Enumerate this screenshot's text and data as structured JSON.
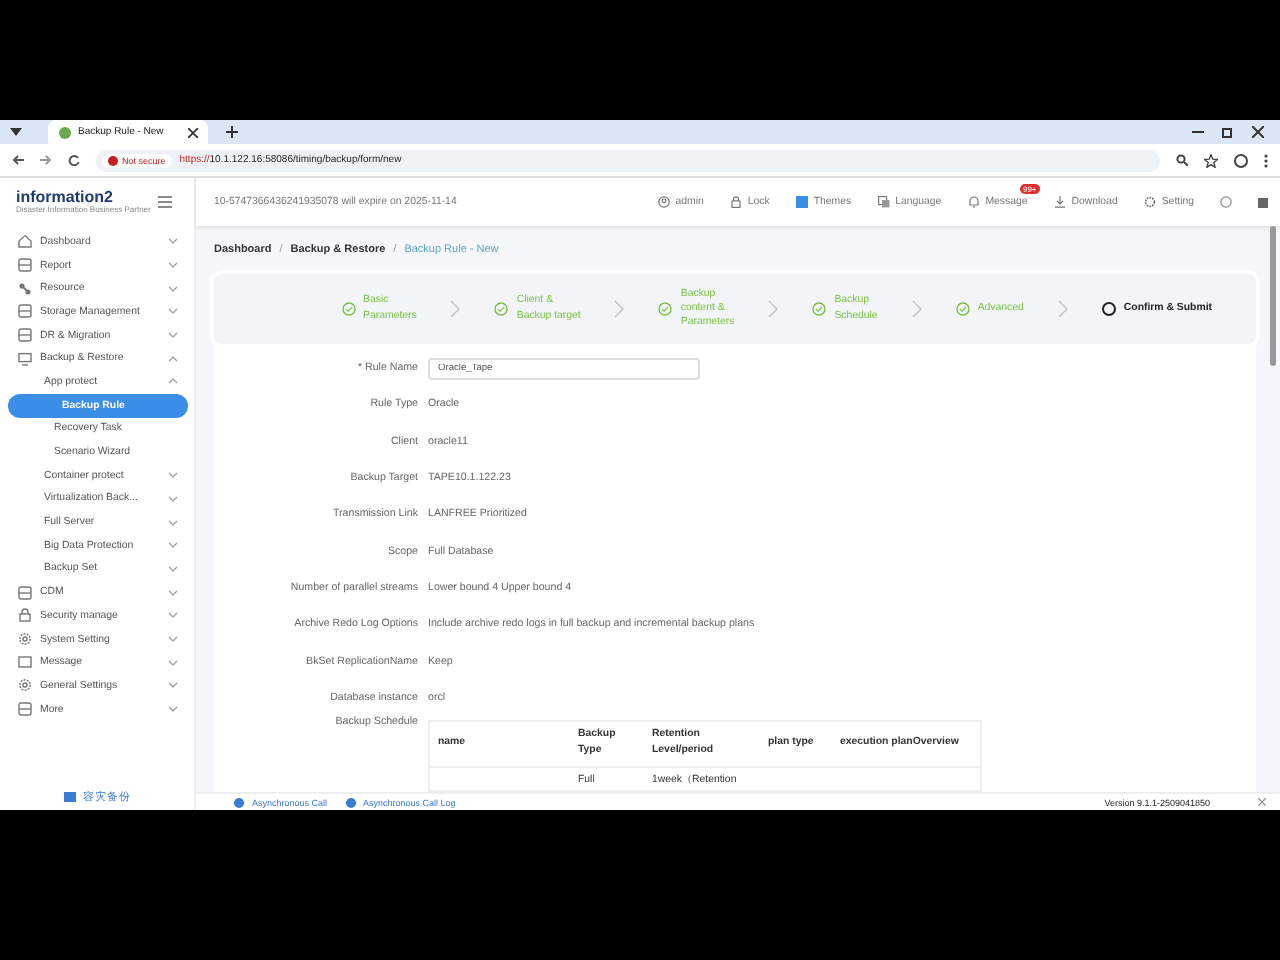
{
  "browser": {
    "tab_title": "Backup Rule - New",
    "security": "Not secure",
    "url_scheme": "https://",
    "url": "10.1.122.16:58086/timing/backup/form/new"
  },
  "header": {
    "logo": "information2",
    "logo_tagline": "Disaster Information Business Partner",
    "license_notice": "10-5747366436241935078 will expire on 2025-11-14",
    "user": "admin",
    "actions": [
      {
        "kind": "lock",
        "label": "Lock"
      },
      {
        "kind": "themes",
        "label": "Themes"
      },
      {
        "kind": "language",
        "label": "Language"
      },
      {
        "kind": "message",
        "label": "Message",
        "badge": "99+"
      },
      {
        "kind": "download",
        "label": "Download"
      },
      {
        "kind": "setting",
        "label": "Setting"
      }
    ]
  },
  "sidebar": {
    "items": [
      {
        "label": "Dashboard",
        "expanded": false,
        "selected": false
      },
      {
        "label": "Report",
        "expanded": false,
        "selected": false
      },
      {
        "label": "Resource",
        "expanded": false,
        "selected": false
      },
      {
        "label": "Storage Management",
        "expanded": false,
        "selected": false
      },
      {
        "label": "DR & Migration",
        "expanded": false,
        "selected": false
      },
      {
        "label": "Backup & Restore",
        "expanded": true,
        "selected": false,
        "children": [
          {
            "label": "App protect",
            "expanded": true,
            "selected": false,
            "children": [
              {
                "label": "Backup Rule",
                "selected": true
              },
              {
                "label": "Recovery Task",
                "selected": false
              },
              {
                "label": "Scenario Wizard",
                "selected": false
              }
            ]
          },
          {
            "label": "Container protect",
            "expanded": false,
            "selected": false
          },
          {
            "label": "Virtualization Back...",
            "expanded": false,
            "selected": false
          },
          {
            "label": "Full Server",
            "expanded": false,
            "selected": false
          },
          {
            "label": "Big Data Protection",
            "expanded": false,
            "selected": false
          },
          {
            "label": "Backup Set",
            "expanded": false,
            "selected": false
          }
        ]
      },
      {
        "label": "CDM",
        "expanded": false,
        "selected": false
      },
      {
        "label": "Security manage",
        "expanded": false,
        "selected": false
      },
      {
        "label": "System Setting",
        "expanded": false,
        "selected": false
      },
      {
        "label": "Message",
        "expanded": false,
        "selected": false
      },
      {
        "label": "General Settings",
        "expanded": false,
        "selected": false
      },
      {
        "label": "More",
        "expanded": false,
        "selected": false
      }
    ],
    "footer_link": "容灾备份"
  },
  "breadcrumb": [
    {
      "label": "Dashboard",
      "current": false
    },
    {
      "separator": "/",
      "label": "Backup & Restore",
      "current": false
    },
    {
      "separator": "/",
      "label": "Backup Rule - New",
      "current": true
    }
  ],
  "steps": [
    {
      "label": "Basic\nParameters",
      "done": true
    },
    {
      "label": "Client &\nBackup target",
      "done": true
    },
    {
      "label": "Backup\ncontent &\nParameters",
      "done": true
    },
    {
      "label": "Backup\nSchedule",
      "done": true
    },
    {
      "label": "Advanced",
      "done": true
    },
    {
      "label": "Confirm & Submit",
      "done": false
    }
  ],
  "form": [
    {
      "kind": "input",
      "label": "* Rule Name",
      "value": "Oracle_Tape"
    },
    {
      "kind": "text",
      "label": "Rule Type",
      "value": "Oracle"
    },
    {
      "kind": "text",
      "label": "Client",
      "value": "oracle11"
    },
    {
      "kind": "text",
      "label": "Backup Target",
      "value": "TAPE10.1.122.23"
    },
    {
      "kind": "text",
      "label": "Transmission Link",
      "value": "LANFREE Prioritized"
    },
    {
      "kind": "text",
      "label": "Scope",
      "value": "Full Database"
    },
    {
      "kind": "text",
      "label": "Number of parallel streams",
      "value": "Lower bound 4  Upper bound  4"
    },
    {
      "kind": "text",
      "label": "Archive Redo Log Options",
      "value": "Include archive redo logs in full backup and incremental backup plans"
    },
    {
      "kind": "text",
      "label": "BkSet ReplicationName",
      "value": "Keep"
    },
    {
      "kind": "text",
      "label": "Database instance",
      "value": "orcl"
    }
  ],
  "schedule": {
    "label": "Backup Schedule",
    "columns": [
      "name",
      "Backup\nType",
      "Retention\nLevel/period",
      "plan type",
      "execution planOverview"
    ],
    "rows": [
      {
        "backup_type": "Full",
        "retention": "1week（Retention"
      }
    ]
  },
  "status_bar": {
    "links": [
      "Asynchronous Call",
      "Asynchronous Call Log"
    ],
    "version": "Version 9.1.1-2509041850"
  }
}
